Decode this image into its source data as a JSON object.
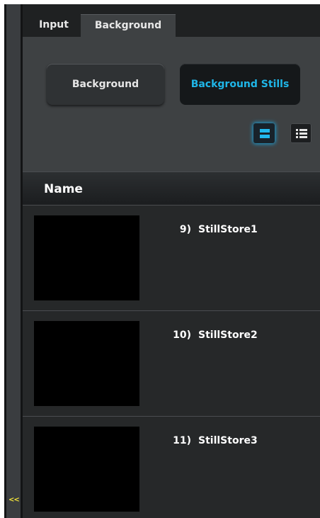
{
  "tabs": [
    {
      "label": "Input",
      "active": false
    },
    {
      "label": "Background",
      "active": true
    }
  ],
  "mode_buttons": [
    {
      "label": "Background",
      "selected": false
    },
    {
      "label": "Background Stills",
      "selected": true
    }
  ],
  "view_toggle": {
    "selected": "grid",
    "options": [
      "grid-view-icon",
      "list-view-icon"
    ]
  },
  "table": {
    "column_header": "Name",
    "rows": [
      {
        "number": "9)",
        "name": "StillStore1"
      },
      {
        "number": "10)",
        "name": "StillStore2"
      },
      {
        "number": "11)",
        "name": "StillStore3"
      }
    ]
  },
  "sidebar": {
    "collapse_label": "<<"
  },
  "colors": {
    "accent": "#1fb6e8",
    "collapse": "#f2e33a"
  }
}
